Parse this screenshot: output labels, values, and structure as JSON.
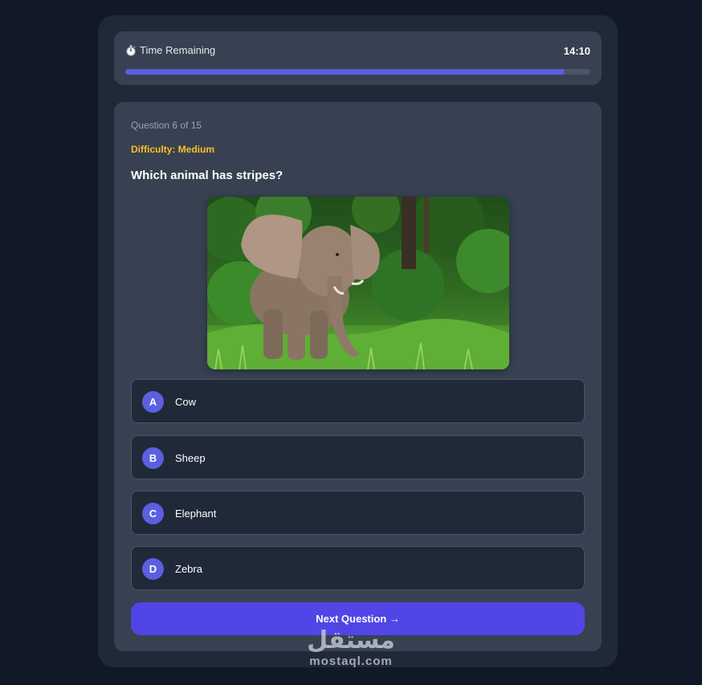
{
  "timer": {
    "label": "Time Remaining",
    "icon": "stopwatch-icon",
    "value": "14:10",
    "progress_fraction": 0.945,
    "progress_color": "#5b5fe0"
  },
  "question": {
    "counter": "Question 6 of 15",
    "difficulty": "Difficulty: Medium",
    "text": "Which animal has stripes?",
    "image": "elephant-in-forest-photo",
    "options": [
      {
        "letter": "A",
        "label": "Cow"
      },
      {
        "letter": "B",
        "label": "Sheep"
      },
      {
        "letter": "C",
        "label": "Elephant"
      },
      {
        "letter": "D",
        "label": "Zebra"
      }
    ]
  },
  "next_button": {
    "label": "Next Question →"
  },
  "watermark": {
    "arabic": "مستقل",
    "latin": "mostaql.com"
  },
  "colors": {
    "background": "#111827",
    "card": "#374151",
    "accent": "#4f46e5",
    "difficulty": "#fbbf24"
  }
}
